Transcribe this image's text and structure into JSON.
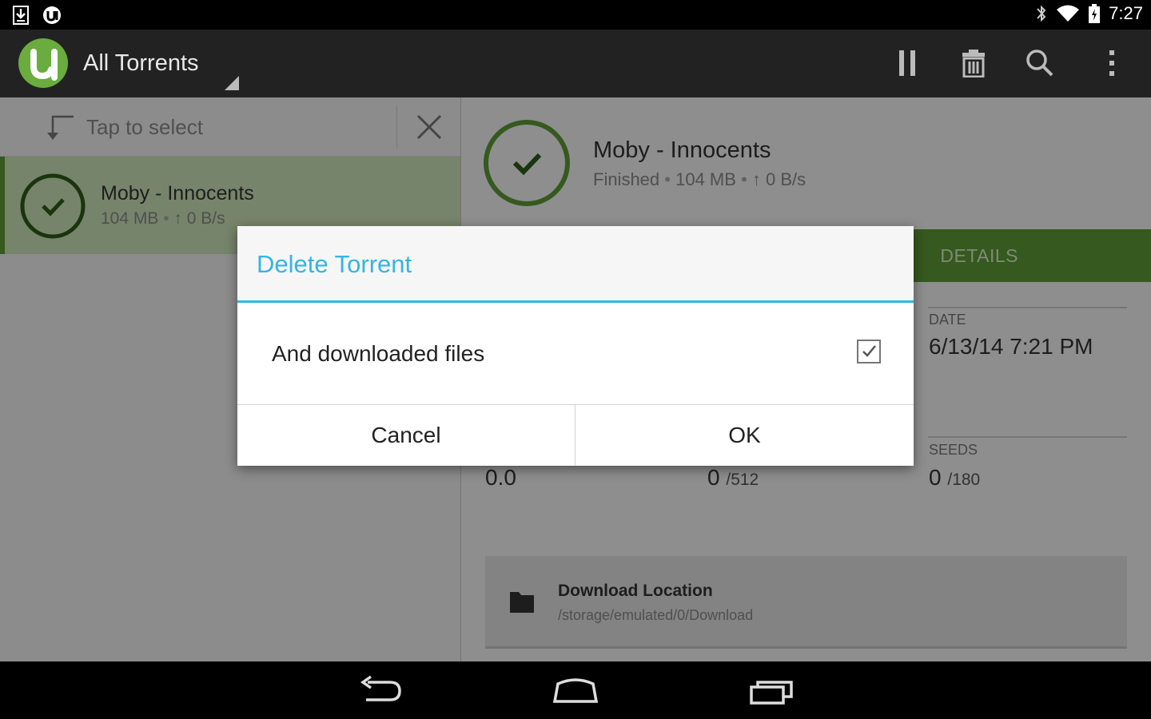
{
  "status_bar": {
    "time": "7:27",
    "icons": [
      "download-notification-icon",
      "utorrent-notification-icon",
      "bluetooth-icon",
      "wifi-icon",
      "battery-charging-icon"
    ]
  },
  "action_bar": {
    "title": "All Torrents",
    "actions": [
      "pause-icon",
      "delete-icon",
      "search-icon",
      "overflow-menu-icon"
    ]
  },
  "left_pane": {
    "tap_to_select": "Tap to select",
    "torrent": {
      "name": "Moby - Innocents",
      "size": "104 MB",
      "upload_speed": "0 B/s"
    }
  },
  "right_pane": {
    "torrent_name": "Moby - Innocents",
    "status": "Finished",
    "size": "104 MB",
    "upload_speed": "0 B/s",
    "tab": "DETAILS",
    "date_label": "DATE",
    "date_value": "6/13/14 7:21 PM",
    "ratio_value": "0.0",
    "peers_value": "0",
    "peers_total": "/512",
    "seeds_label": "SEEDS",
    "seeds_value": "0",
    "seeds_total": "/180",
    "download_location_label": "Download Location",
    "download_location_path": "/storage/emulated/0/Download"
  },
  "dialog": {
    "title": "Delete Torrent",
    "option_label": "And downloaded files",
    "option_checked": true,
    "cancel_label": "Cancel",
    "ok_label": "OK"
  },
  "colors": {
    "accent_blue": "#33b5e5",
    "utorrent_green": "#5c9a34",
    "actionbar": "#222222"
  }
}
